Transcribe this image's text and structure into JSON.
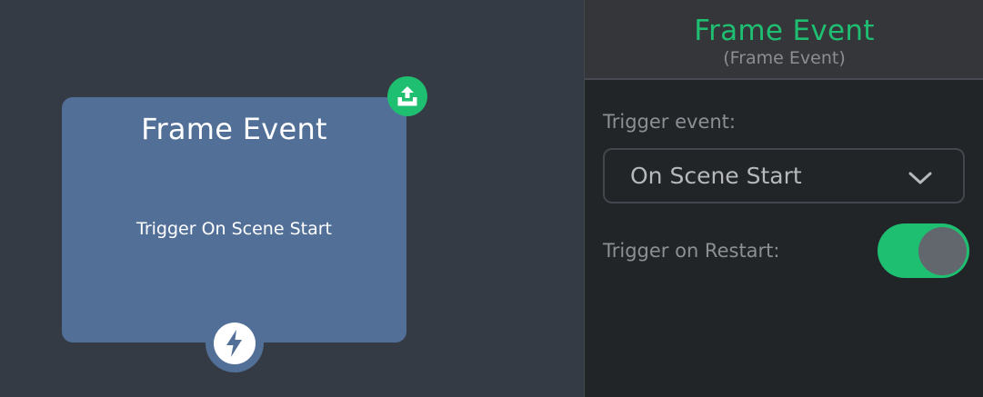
{
  "canvas": {
    "node": {
      "title": "Frame Event",
      "description": "Trigger On Scene Start",
      "output_port_icon": "upload-tray-icon",
      "trigger_port_icon": "lightning-bolt-icon"
    }
  },
  "panel": {
    "title": "Frame Event",
    "subtitle": "(Frame Event)",
    "trigger_event": {
      "label": "Trigger event:",
      "value": "On Scene Start",
      "icon": "chevron-down-icon"
    },
    "trigger_on_restart": {
      "label": "Trigger on Restart:",
      "enabled": true
    }
  },
  "colors": {
    "accent": "#1fbf72",
    "node": "#526f98",
    "canvas": "#353b44",
    "panel": "#222528"
  }
}
